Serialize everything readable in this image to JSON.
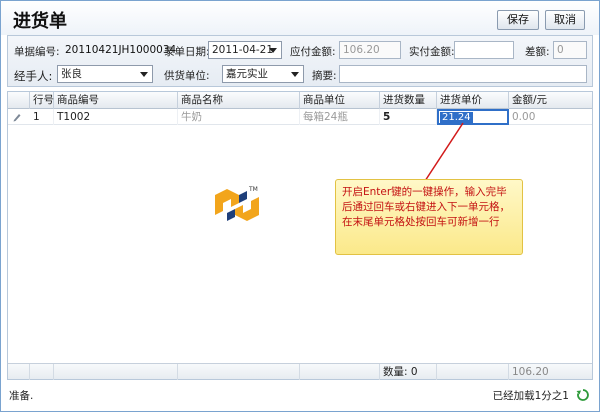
{
  "header": {
    "title": "进货单",
    "save_label": "保存",
    "cancel_label": "取消"
  },
  "form": {
    "order_no_label": "单据编号:",
    "order_no": "20110421JH1000034",
    "date_label": "录单日期:",
    "date_value": "2011-04-21",
    "payable_label": "应付金额:",
    "payable_value": "106.20",
    "paid_label": "实付金额:",
    "paid_value": "",
    "diff_label": "差额:",
    "diff_value": "0",
    "handler_label": "经手人:",
    "handler_value": "张良",
    "supplier_label": "供货单位:",
    "supplier_value": "嘉元实业",
    "summary_label": "摘要:",
    "summary_value": ""
  },
  "grid": {
    "columns": [
      "行号",
      "商品编号",
      "商品名称",
      "商品单位",
      "进货数量",
      "进货单价",
      "金额/元"
    ],
    "rows": [
      {
        "no": "1",
        "code": "T1002",
        "name": "牛奶",
        "unit": "每箱24瓶",
        "qty": "5",
        "price": "21.24",
        "amount": "0.00"
      }
    ],
    "footer": {
      "qty_label": "数量: 0",
      "amount_total": "106.20"
    }
  },
  "status": {
    "left": "准备.",
    "right": "已经加载1分之1"
  },
  "callout": {
    "text": "开启Enter键的一键操作，输入完毕后通过回车或右键进入下一单元格，在末尾单元格处按回车可新增一行"
  },
  "logo": {
    "mark": "TM"
  },
  "colors": {
    "accent": "#2f6fc8",
    "callout_text": "#c41212",
    "callout_bg": "#fbe98a",
    "border": "#7aa3cf"
  }
}
